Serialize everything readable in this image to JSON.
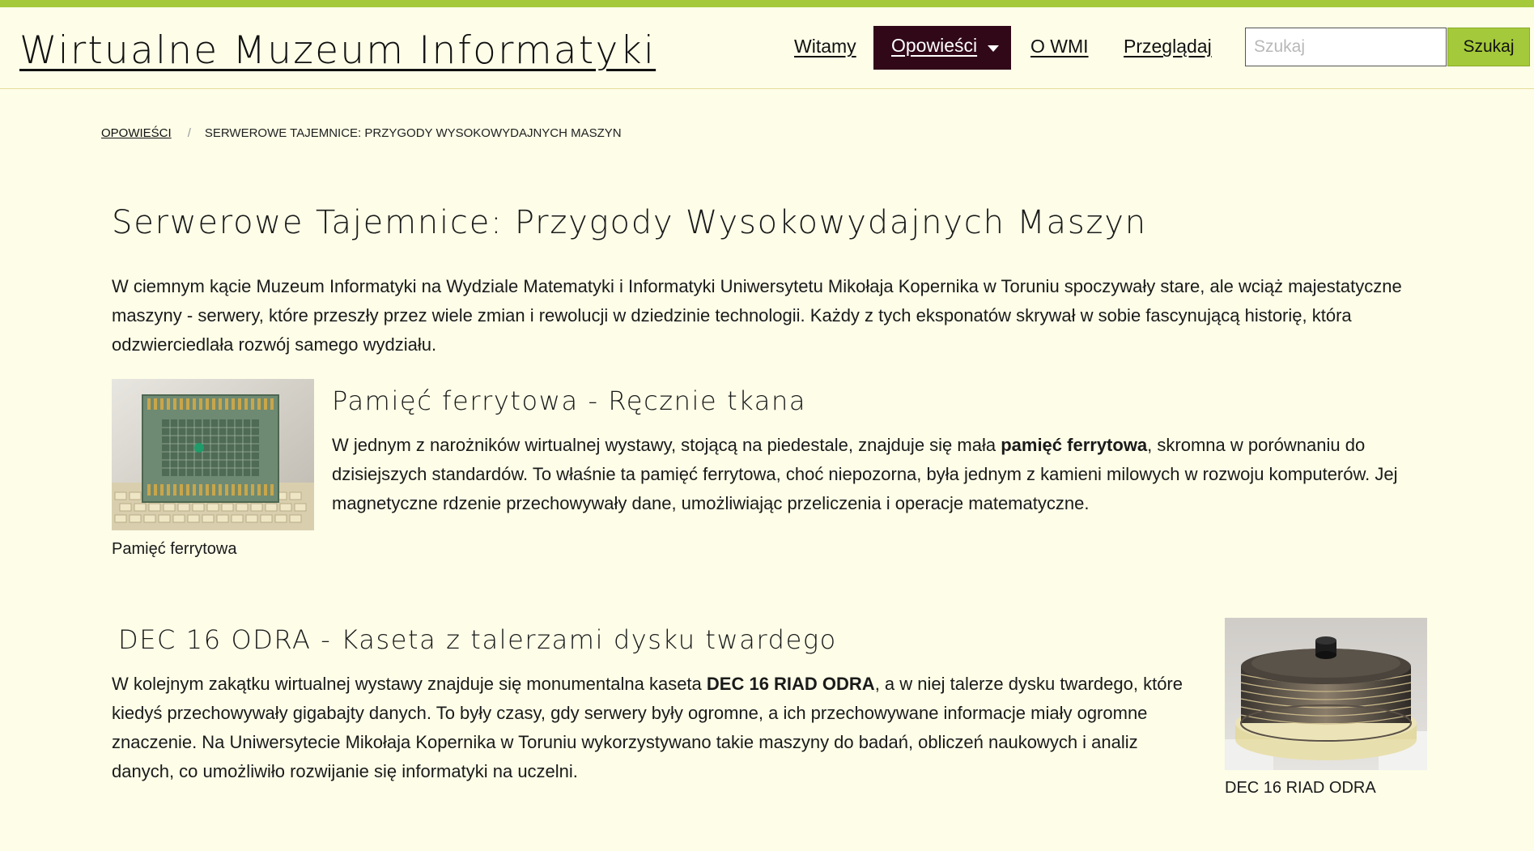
{
  "header": {
    "site_title": "Wirtualne Muzeum Informatyki",
    "nav": {
      "witamy": "Witamy",
      "opowiesci": "Opowieści",
      "owmi": "O WMI",
      "przegladaj": "Przeglądaj"
    },
    "search": {
      "placeholder": "Szukaj",
      "button": "Szukaj"
    }
  },
  "breadcrumb": {
    "parent": "OPOWIEŚCI",
    "separator": "/",
    "current": "SERWEROWE TAJEMNICE: PRZYGODY WYSOKOWYDAJNYCH MASZYN"
  },
  "article": {
    "title": "Serwerowe Tajemnice: Przygody Wysokowydajnych Maszyn",
    "intro": "W ciemnym kącie Muzeum Informatyki na Wydziale Matematyki i Informatyki Uniwersytetu Mikołaja Kopernika w Toruniu spoczywały stare, ale wciąż majestatyczne maszyny - serwery, które przeszły przez wiele zmian i rewolucji w dziedzinie technologii. Każdy z tych eksponatów skrywał w sobie fascynującą historię, która odzwierciedlała rozwój samego wydziału.",
    "sections": [
      {
        "title": "Pamięć ferrytowa - Ręcznie tkana",
        "text_before": "W jednym z narożników wirtualnej wystawy, stojącą na piedestale, znajduje się mała ",
        "text_bold": "pamięć ferrytowa",
        "text_after": ", skromna w porównaniu do dzisiejszych standardów. To właśnie ta pamięć ferrytowa, choć niepozorna, była jednym z kamieni milowych w rozwoju komputerów. Jej magnetyczne rdzenie przechowywały dane, umożliwiając przeliczenia i operacje matematyczne.",
        "caption": "Pamięć ferrytowa"
      },
      {
        "title": "DEC 16 ODRA - Kaseta z talerzami dysku twardego",
        "text_before": "W kolejnym zakątku wirtualnej wystawy znajduje się monumentalna kaseta ",
        "text_bold": "DEC 16 RIAD ODRA",
        "text_after": ", a w niej talerze dysku twardego, które kiedyś przechowywały gigabajty danych. To były czasy, gdy serwery były ogromne, a ich przechowywane informacje miały ogromne znaczenie. Na Uniwersytecie Mikołaja Kopernika w Toruniu wykorzystywano takie maszyny do badań, obliczeń naukowych i analiz danych, co umożliwiło rozwijanie się informatyki na uczelni.",
        "caption": "DEC 16 RIAD ODRA"
      }
    ]
  },
  "colors": {
    "background": "#fdfde8",
    "accent": "#a4c93a",
    "nav_active": "#300818"
  }
}
